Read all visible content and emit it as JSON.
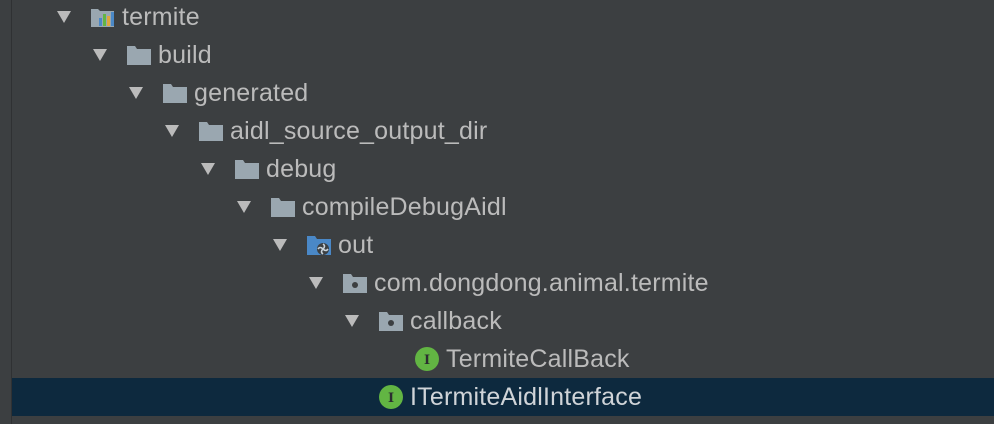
{
  "tree": {
    "nodes": [
      {
        "label": "termite",
        "icon": "module-icon",
        "expanded": true
      },
      {
        "label": "build",
        "icon": "folder-icon",
        "expanded": true
      },
      {
        "label": "generated",
        "icon": "folder-icon",
        "expanded": true
      },
      {
        "label": "aidl_source_output_dir",
        "icon": "folder-icon",
        "expanded": true
      },
      {
        "label": "debug",
        "icon": "folder-icon",
        "expanded": true
      },
      {
        "label": "compileDebugAidl",
        "icon": "folder-icon",
        "expanded": true
      },
      {
        "label": "out",
        "icon": "generated-sources-folder-icon",
        "expanded": true
      },
      {
        "label": "com.dongdong.animal.termite",
        "icon": "package-icon",
        "expanded": true
      },
      {
        "label": "callback",
        "icon": "package-icon",
        "expanded": true
      },
      {
        "label": "TermiteCallBack",
        "icon": "interface-icon",
        "expanded": false
      },
      {
        "label": "ITermiteAidlInterface",
        "icon": "interface-icon",
        "expanded": false,
        "selected": true
      }
    ]
  },
  "colors": {
    "background": "#3c3f41",
    "selection": "#0d293e",
    "text": "#bbbbbb",
    "folder": "#9aa7b0",
    "interface_badge": "#62b543"
  }
}
